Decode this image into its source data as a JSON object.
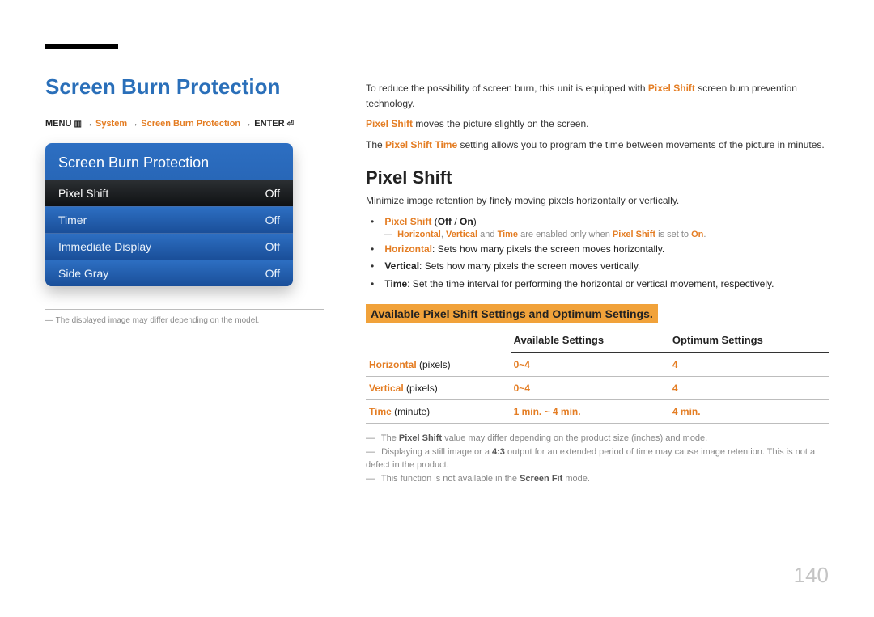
{
  "page_number": "140",
  "heading": "Screen Burn Protection",
  "breadcrumb": {
    "prefix": "MENU",
    "menu_icon": "▥",
    "arrow": " → ",
    "system": "System",
    "sbp": "Screen Burn Protection",
    "enter": "ENTER",
    "enter_icon": "⏎"
  },
  "menu_panel": {
    "title": "Screen Burn Protection",
    "rows": [
      {
        "label": "Pixel Shift",
        "value": "Off",
        "selected": true
      },
      {
        "label": "Timer",
        "value": "Off",
        "selected": false
      },
      {
        "label": "Immediate Display",
        "value": "Off",
        "selected": false
      },
      {
        "label": "Side Gray",
        "value": "Off",
        "selected": false
      }
    ]
  },
  "disclaimer": "The displayed image may differ depending on the model.",
  "intro": {
    "p1_pre": "To reduce the possibility of screen burn, this unit is equipped with ",
    "p1_hl": "Pixel Shift",
    "p1_post": " screen burn prevention technology.",
    "p2_hl": "Pixel Shift",
    "p2_post": " moves the picture slightly on the screen.",
    "p3_pre": "The ",
    "p3_hl": "Pixel Shift Time",
    "p3_post": " setting allows you to program the time between movements of the picture in minutes."
  },
  "sub_heading": "Pixel Shift",
  "sub_intro": "Minimize image retention by finely moving pixels horizontally or vertically.",
  "bullets": {
    "b1_hl": "Pixel Shift",
    "b1_paren_open": " (",
    "b1_off": "Off",
    "b1_slash": " / ",
    "b1_on": "On",
    "b1_paren_close": ")",
    "note_h": "Horizontal",
    "note_sep1": ", ",
    "note_v": "Vertical",
    "note_and": " and ",
    "note_t": "Time",
    "note_mid": " are enabled only when ",
    "note_ps": "Pixel Shift",
    "note_tail": " is set to ",
    "note_on": "On",
    "note_dot": ".",
    "b2_hl": "Horizontal",
    "b2_post": ": Sets how many pixels the screen moves horizontally.",
    "b3_hl": "Vertical",
    "b3_post": ": Sets how many pixels the screen moves vertically.",
    "b4_hl": "Time",
    "b4_post": ": Set the time interval for performing the horizontal or vertical movement, respectively."
  },
  "table_heading": "Available Pixel Shift Settings and Optimum Settings.",
  "table": {
    "col_blank": "",
    "col_avail": "Available Settings",
    "col_opt": "Optimum Settings",
    "rows": [
      {
        "label_hl": "Horizontal",
        "label_unit": " (pixels)",
        "avail": "0~4",
        "opt": "4"
      },
      {
        "label_hl": "Vertical",
        "label_unit": " (pixels)",
        "avail": "0~4",
        "opt": "4"
      },
      {
        "label_hl": "Time",
        "label_unit": " (minute)",
        "avail": "1 min. ~ 4 min.",
        "opt": "4 min."
      }
    ]
  },
  "notes": {
    "n1_pre": "The ",
    "n1_hl": "Pixel Shift",
    "n1_post": " value may differ depending on the product size (inches) and mode.",
    "n2_pre": "Displaying a still image or a ",
    "n2_hl": "4:3",
    "n2_post": " output for an extended period of time may cause image retention. This is not a defect in the product.",
    "n3_pre": "This function is not available in the ",
    "n3_hl": "Screen Fit",
    "n3_post": " mode."
  }
}
